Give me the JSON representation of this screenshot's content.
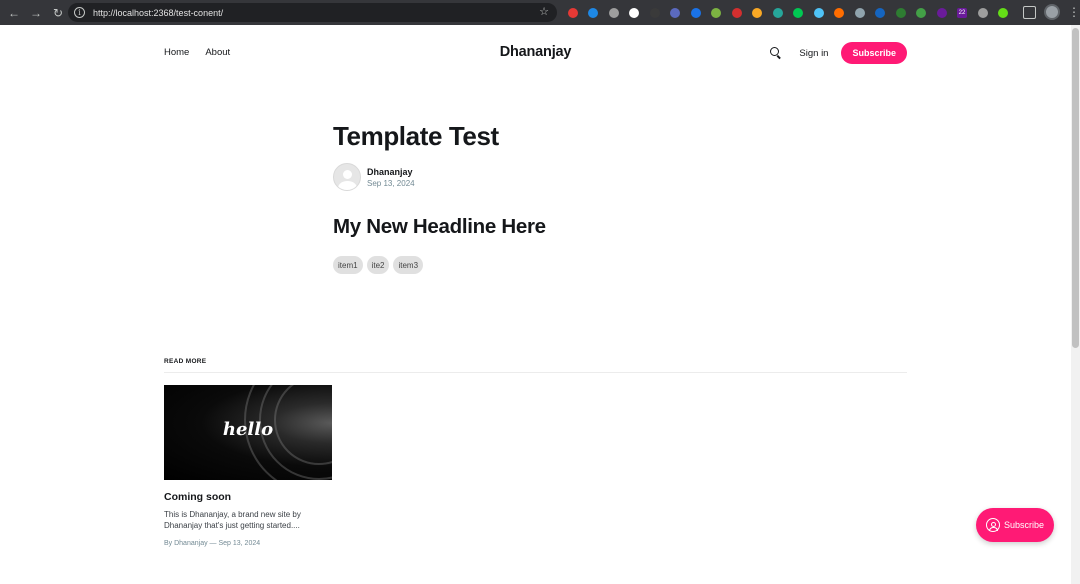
{
  "browser": {
    "url": "http://localhost:2368/test-conent/",
    "extension_colors": [
      "#e53935",
      "#1e88e5",
      "#9e9e9e",
      "#ffffff",
      "#3a3a3a",
      "#5b6abf",
      "#1a73e8",
      "#7cb342",
      "#d32f2f",
      "#f9a825",
      "#26a69a",
      "#00c853",
      "#4fc3f7",
      "#ff6d00",
      "#90a4ae",
      "#1565c0",
      "#2e7d32",
      "#43a047",
      "#6a1b9a",
      "#757575",
      "#9e9e9e",
      "#64dd17"
    ],
    "badge": "22"
  },
  "site": {
    "title": "Dhananjay",
    "nav": [
      {
        "label": "Home"
      },
      {
        "label": "About"
      }
    ],
    "signin_label": "Sign in",
    "subscribe_label": "Subscribe",
    "accent_color": "#ff1a75"
  },
  "article": {
    "title": "Template Test",
    "author": "Dhananjay",
    "date": "Sep 13, 2024",
    "headline": "My New Headline Here",
    "chips": [
      "item1",
      "ite2",
      "item3"
    ]
  },
  "read_more": {
    "label": "READ MORE",
    "cards": [
      {
        "image_text": "hello",
        "title": "Coming soon",
        "excerpt": "This is Dhananjay, a brand new site by Dhananjay that's just getting started....",
        "meta": "By Dhananjay — Sep 13, 2024"
      }
    ]
  },
  "portal": {
    "label": "Subscribe"
  }
}
